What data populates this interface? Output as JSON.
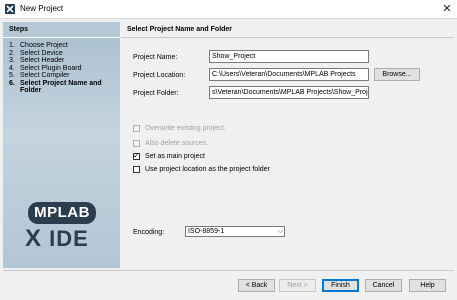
{
  "window": {
    "title": "New Project",
    "close_glyph": "✕"
  },
  "steps": {
    "title": "Steps",
    "items": [
      {
        "num": "1.",
        "label": "Choose Project"
      },
      {
        "num": "2.",
        "label": "Select Device"
      },
      {
        "num": "3.",
        "label": "Select Header"
      },
      {
        "num": "4.",
        "label": "Select Plugin Board"
      },
      {
        "num": "5.",
        "label": "Select Compiler"
      },
      {
        "num": "6.",
        "label": "Select Project Name and Folder"
      }
    ]
  },
  "logo": {
    "top": "MPLAB",
    "bottom_x": "X",
    "bottom_ide": "IDE"
  },
  "content": {
    "title": "Select Project Name and Folder",
    "project_name_label": "Project Name:",
    "project_name_value": "Show_Project",
    "project_location_label": "Project Location:",
    "project_location_value": "C:\\Users\\Veteran\\Documents\\MPLAB Projects",
    "browse_label": "Browse...",
    "project_folder_label": "Project Folder:",
    "project_folder_value": "s\\Veteran\\Documents\\MPLAB Projects\\Show_Project.X",
    "options": {
      "overwrite": {
        "label": "Overwrite existing project.",
        "checked": false,
        "enabled": false
      },
      "delete_sources": {
        "label": "Also delete sources.",
        "checked": false,
        "enabled": false
      },
      "main_project": {
        "label": "Set as main project",
        "checked": true,
        "enabled": true
      },
      "use_location": {
        "label": "Use project location as the project folder",
        "checked": false,
        "enabled": true
      }
    },
    "encoding_label": "Encoding:",
    "encoding_value": "ISO-8859-1"
  },
  "buttons": {
    "back": "< Back",
    "next": "Next >",
    "finish": "Finish",
    "cancel": "Cancel",
    "help": "Help"
  },
  "icons": {
    "app": "mplab-app-icon",
    "check": "check-icon",
    "dropdown": "chevron-down-icon"
  }
}
